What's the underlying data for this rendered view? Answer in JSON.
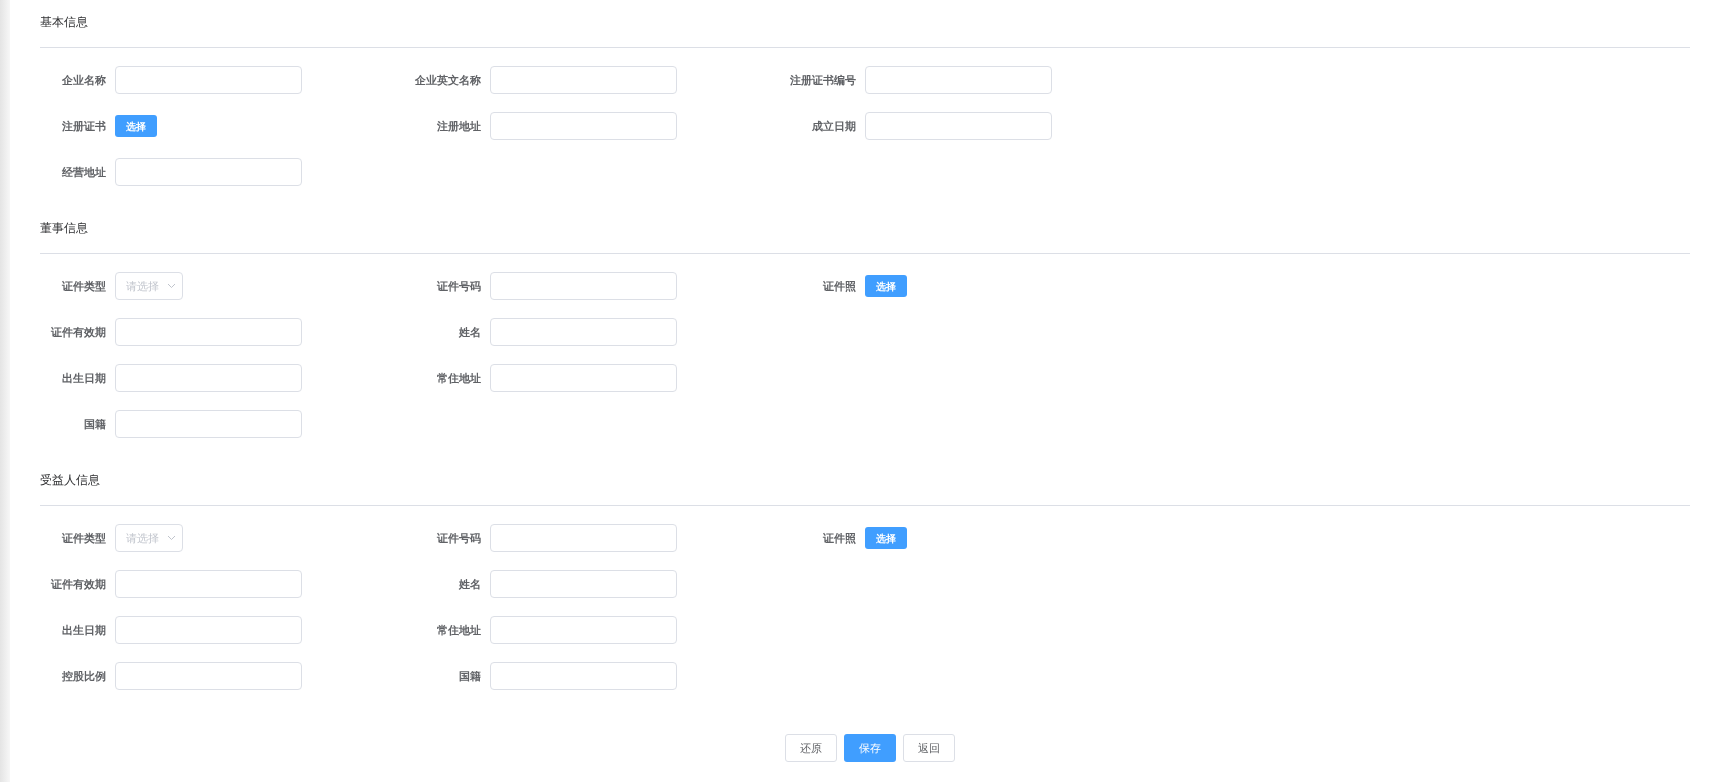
{
  "sections": [
    {
      "title": "基本信息",
      "rows": [
        [
          {
            "kind": "input",
            "label": "企业名称"
          },
          {
            "kind": "input",
            "label": "企业英文名称"
          },
          {
            "kind": "input",
            "label": "注册证书编号"
          }
        ],
        [
          {
            "kind": "upload",
            "label": "注册证书",
            "button": "选择"
          },
          {
            "kind": "input",
            "label": "注册地址"
          },
          {
            "kind": "input",
            "label": "成立日期"
          }
        ],
        [
          {
            "kind": "input",
            "label": "经营地址"
          }
        ]
      ]
    },
    {
      "title": "董事信息",
      "rows": [
        [
          {
            "kind": "select",
            "label": "证件类型",
            "placeholder": "请选择"
          },
          {
            "kind": "input",
            "label": "证件号码"
          },
          {
            "kind": "upload",
            "label": "证件照",
            "button": "选择"
          }
        ],
        [
          {
            "kind": "input",
            "label": "证件有效期"
          },
          {
            "kind": "input",
            "label": "姓名"
          }
        ],
        [
          {
            "kind": "input",
            "label": "出生日期"
          },
          {
            "kind": "input",
            "label": "常住地址"
          }
        ],
        [
          {
            "kind": "input",
            "label": "国籍"
          }
        ]
      ]
    },
    {
      "title": "受益人信息",
      "rows": [
        [
          {
            "kind": "select",
            "label": "证件类型",
            "placeholder": "请选择"
          },
          {
            "kind": "input",
            "label": "证件号码"
          },
          {
            "kind": "upload",
            "label": "证件照",
            "button": "选择"
          }
        ],
        [
          {
            "kind": "input",
            "label": "证件有效期"
          },
          {
            "kind": "input",
            "label": "姓名"
          }
        ],
        [
          {
            "kind": "input",
            "label": "出生日期"
          },
          {
            "kind": "input",
            "label": "常住地址"
          }
        ],
        [
          {
            "kind": "input",
            "label": "控股比例"
          },
          {
            "kind": "input",
            "label": "国籍"
          }
        ]
      ]
    }
  ],
  "actions": [
    {
      "label": "还原",
      "primary": false
    },
    {
      "label": "保存",
      "primary": true
    },
    {
      "label": "返回",
      "primary": false
    }
  ]
}
